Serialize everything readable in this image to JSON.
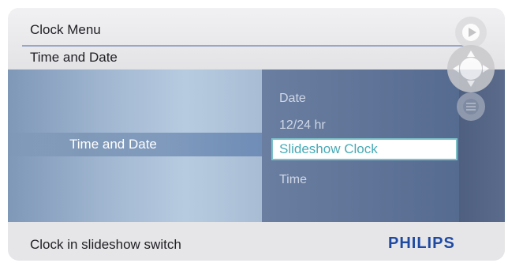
{
  "header": {
    "menu_title": "Clock Menu",
    "submenu_title": "Time and Date"
  },
  "left_menu": {
    "selected_label": "Time and Date"
  },
  "options": [
    {
      "label": "Date",
      "selected": false
    },
    {
      "label": "12/24 hr",
      "selected": false
    },
    {
      "label": "Slideshow Clock",
      "selected": true
    },
    {
      "label": "Time",
      "selected": false
    }
  ],
  "footer": {
    "status": "Clock in slideshow switch",
    "brand": "PHILIPS"
  },
  "controls": {
    "icons": [
      "play-slideshow-icon",
      "navigation-dpad-icon",
      "menu-icon"
    ]
  },
  "colors": {
    "brand": "#1f4aa3",
    "selection_text": "#47aab6",
    "selection_border": "#7cc1c8",
    "panel": "#5b6f93"
  }
}
